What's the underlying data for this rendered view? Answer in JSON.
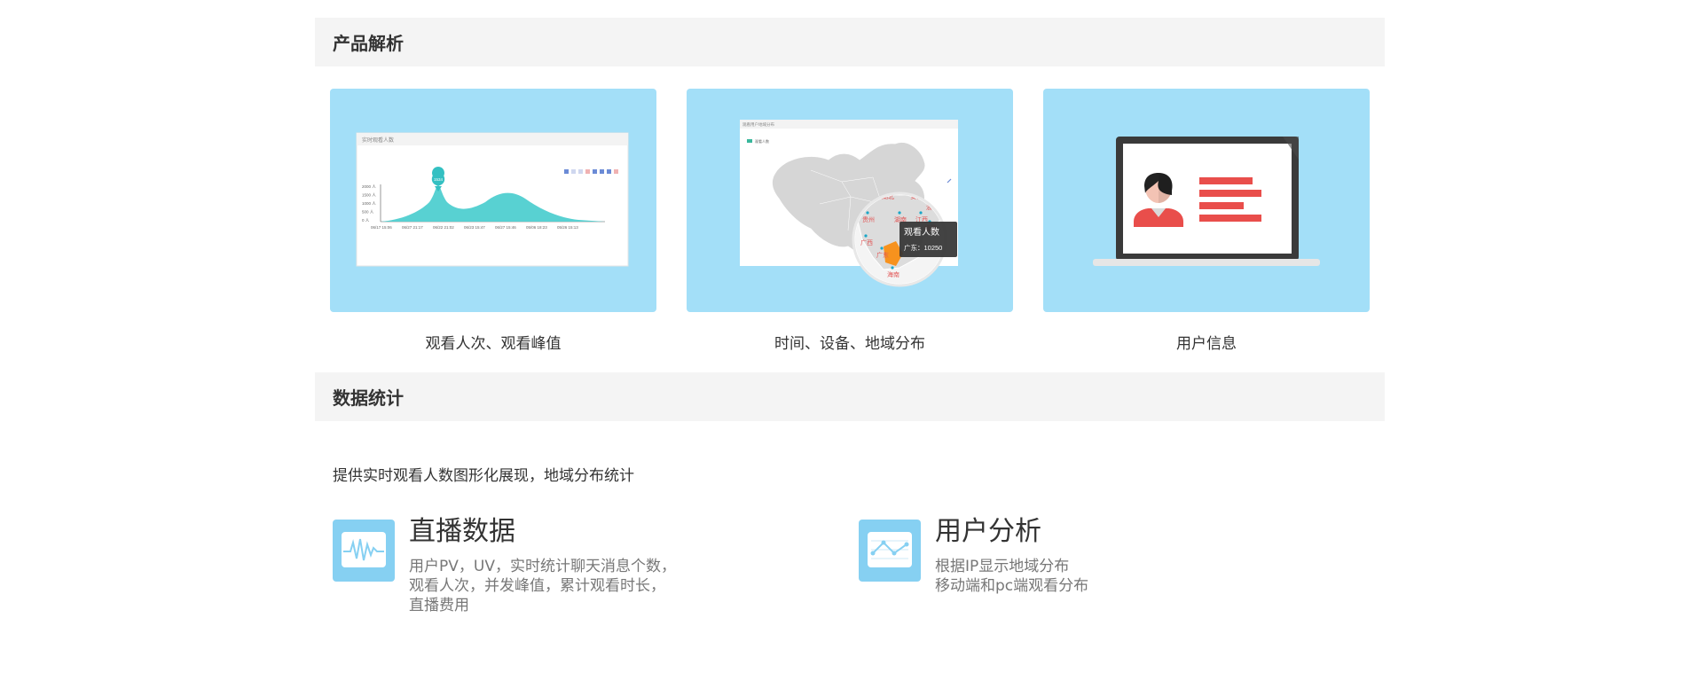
{
  "product_section": {
    "title": "产品解析",
    "cards": [
      {
        "caption": "观看人次、观看峰值",
        "mock": {
          "panel_title": "实时观看人数",
          "y_ticks": [
            "2000 人",
            "1500 人",
            "1000 人",
            "500 人",
            "0 人"
          ],
          "x_ticks": [
            "06/17 15:06",
            "06/27 21:17",
            "06/22 21:02",
            "06/23 15:47",
            "06/27 15:46",
            "05/06 18:23",
            "05/26 15:13"
          ],
          "peak_label": "1534",
          "line_color": "#4fcfd0"
        }
      },
      {
        "caption": "时间、设备、地域分布",
        "mock": {
          "panel_title": "观看用户地域分布",
          "legend_label": "观看人数",
          "provinces": [
            "湖北",
            "安徽",
            "贵州",
            "湖南",
            "江西",
            "浙江",
            "广西",
            "福建",
            "广东",
            "海南"
          ],
          "tooltip_title": "观看人数",
          "tooltip_value": "广东：10250",
          "highlight_color": "#f7921e"
        }
      },
      {
        "caption": "用户信息",
        "mock": {
          "accent_color": "#e94e4b"
        }
      }
    ]
  },
  "stats_section": {
    "title": "数据统计",
    "intro": "提供实时观看人数图形化展现，地域分布统计",
    "features": [
      {
        "icon": "pulse-chart-icon",
        "title": "直播数据",
        "desc": "用户PV，UV，实时统计聊天消息个数，\n观看人次，并发峰值，累计观看时长，\n直播费用"
      },
      {
        "icon": "line-graph-icon",
        "title": "用户分析",
        "desc": "根据IP显示地域分布\n移动端和pc端观看分布"
      }
    ]
  }
}
